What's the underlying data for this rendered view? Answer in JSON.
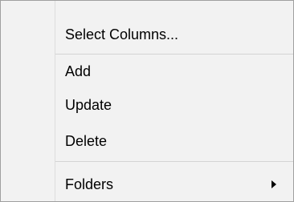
{
  "context_menu": {
    "items": [
      {
        "label": "Select Columns..."
      },
      {
        "label": "Add"
      },
      {
        "label": "Update"
      },
      {
        "label": "Delete"
      },
      {
        "label": "Folders",
        "icon": "chevron-right-icon",
        "has_submenu": true
      }
    ]
  }
}
